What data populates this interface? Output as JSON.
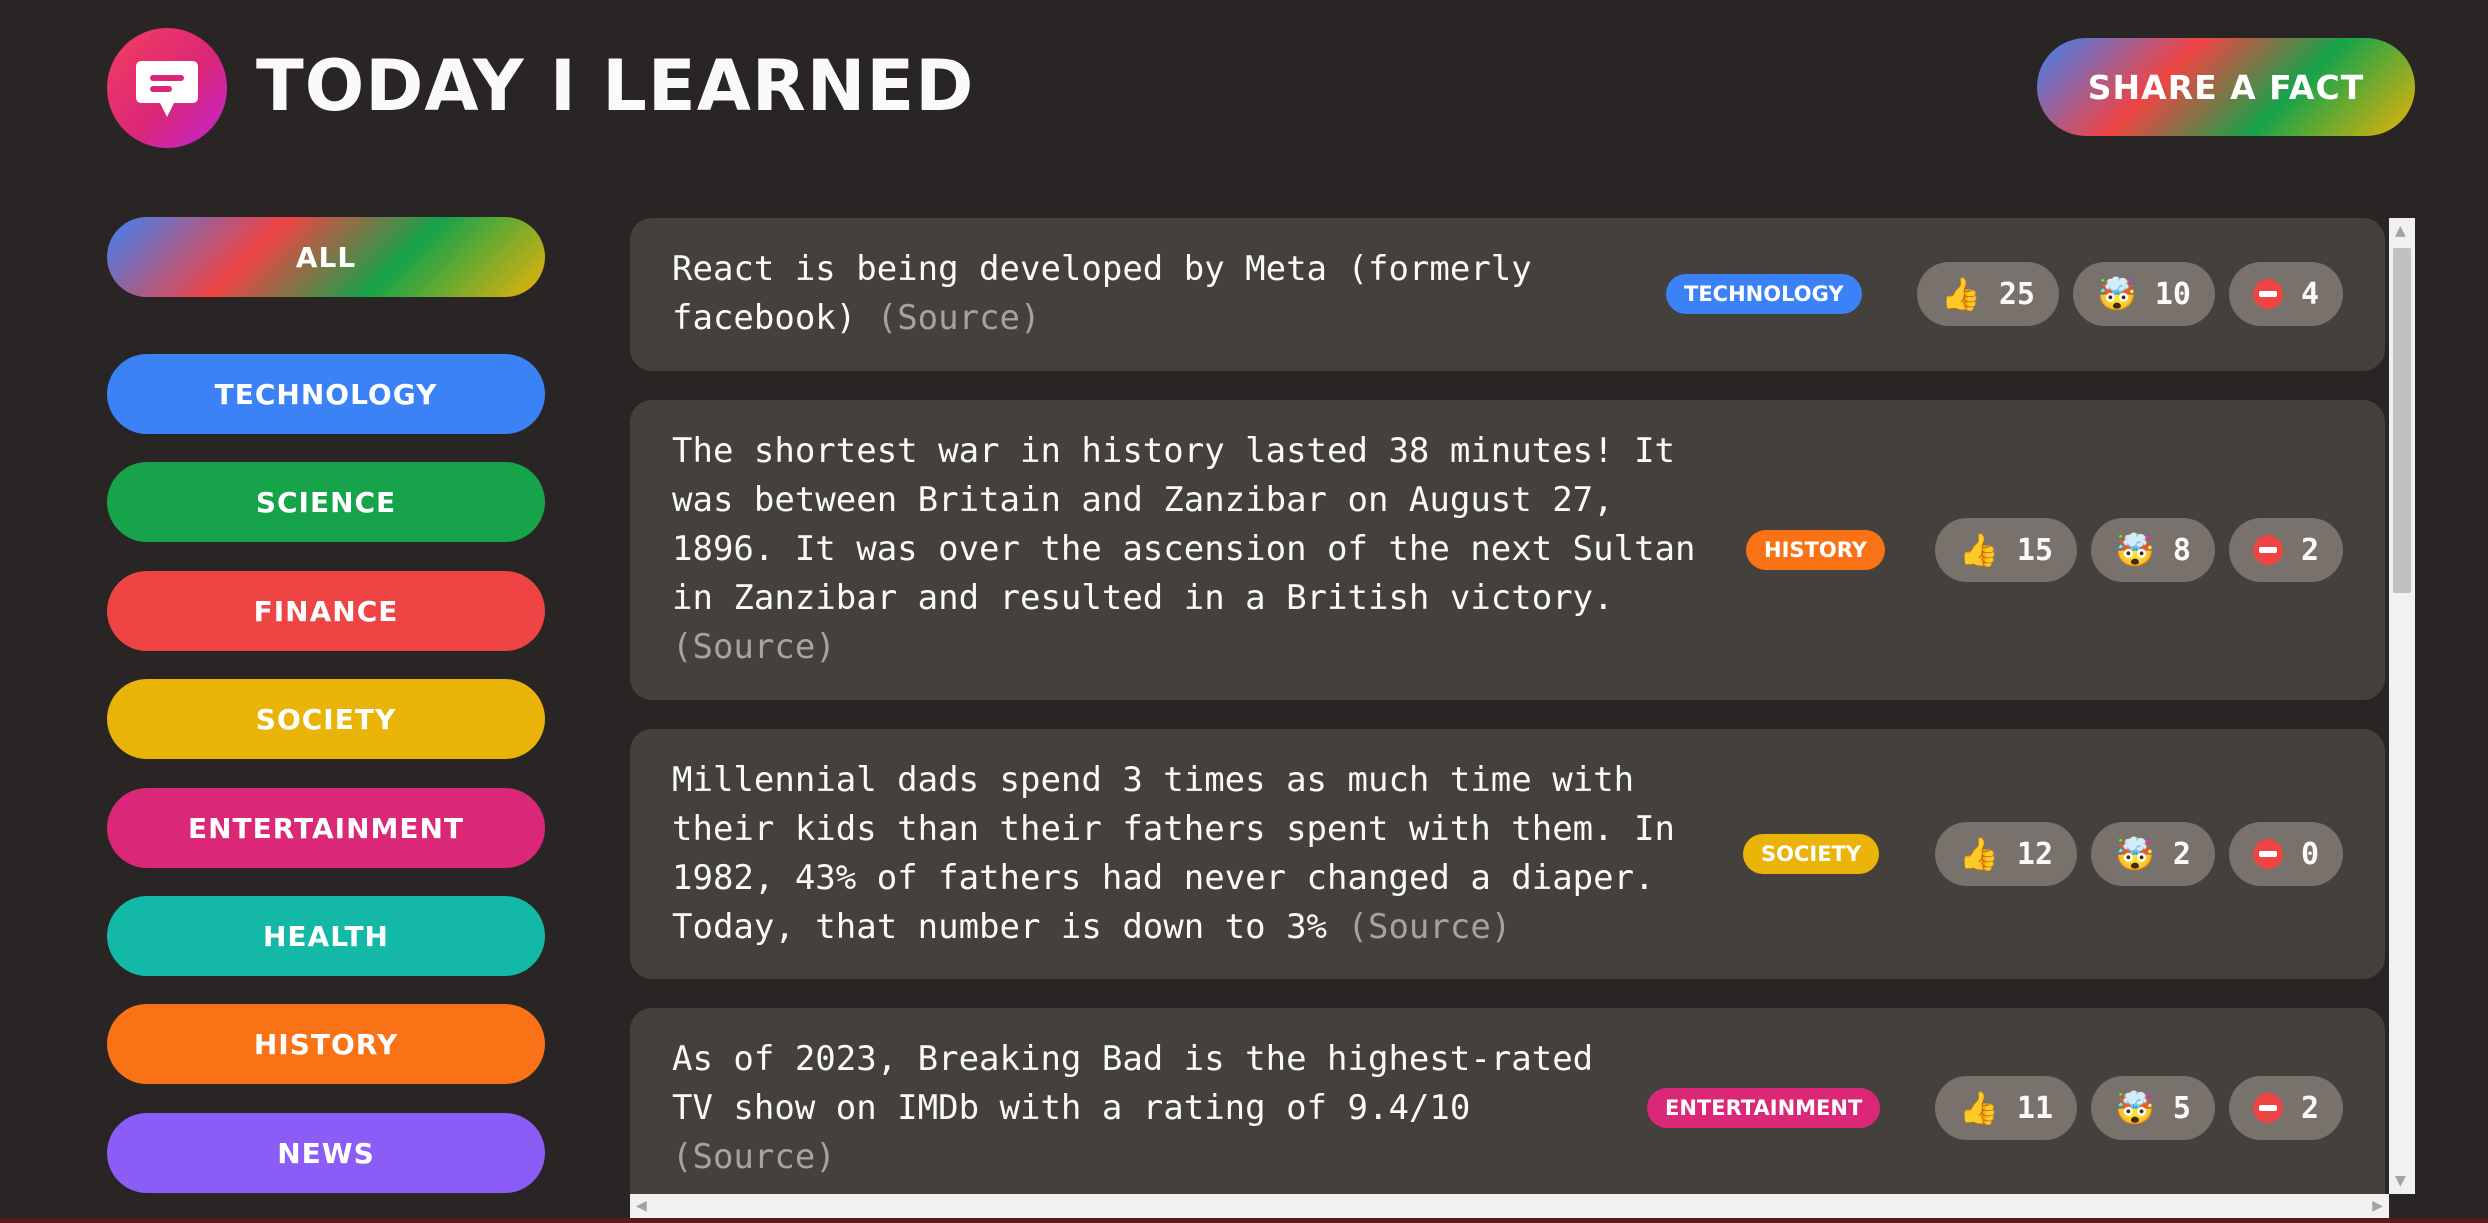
{
  "header": {
    "title": "Today I Learned",
    "share_label": "Share a fact",
    "logo_icon": "speech-bubble-icon"
  },
  "sidebar": {
    "items": [
      {
        "label": "All",
        "color": "gradient"
      },
      {
        "label": "technology",
        "color": "#3b82f6"
      },
      {
        "label": "science",
        "color": "#16a34a"
      },
      {
        "label": "finance",
        "color": "#ef4444"
      },
      {
        "label": "society",
        "color": "#eab308"
      },
      {
        "label": "entertainment",
        "color": "#db2777"
      },
      {
        "label": "health",
        "color": "#14b8a6"
      },
      {
        "label": "history",
        "color": "#f97316"
      },
      {
        "label": "news",
        "color": "#8b5cf6"
      }
    ]
  },
  "facts": [
    {
      "text": "React is being developed by Meta (formerly facebook)",
      "source_label": "(Source)",
      "category": "technology",
      "category_color": "#3b82f6",
      "votes_interesting": 25,
      "votes_mindblowing": 10,
      "votes_false": 4
    },
    {
      "text": "The shortest war in history lasted 38 minutes! It was between Britain and Zanzibar on August 27, 1896. It was over the ascension of the next Sultan in Zanzibar and resulted in a British victory.",
      "source_label": "(Source)",
      "category": "history",
      "category_color": "#f97316",
      "votes_interesting": 15,
      "votes_mindblowing": 8,
      "votes_false": 2
    },
    {
      "text": "Millennial dads spend 3 times as much time with their kids than their fathers spent with them. In 1982, 43% of fathers had never changed a diaper. Today, that number is down to 3%",
      "source_label": "(Source)",
      "category": "society",
      "category_color": "#eab308",
      "votes_interesting": 12,
      "votes_mindblowing": 2,
      "votes_false": 0
    },
    {
      "text": "As of 2023, Breaking Bad is the highest-rated TV show on IMDb with a rating of 9.4/10",
      "source_label": "(Source)",
      "category": "entertainment",
      "category_color": "#db2777",
      "votes_interesting": 11,
      "votes_mindblowing": 5,
      "votes_false": 2
    }
  ],
  "vote_icons": {
    "interesting": "thumbs-up-icon",
    "mindblowing": "exploding-head-icon",
    "false": "no-entry-icon"
  }
}
